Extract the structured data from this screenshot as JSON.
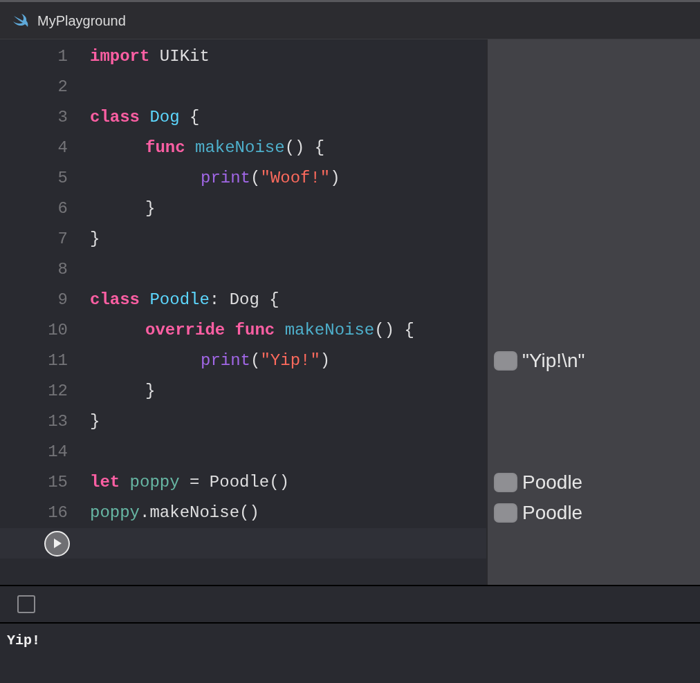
{
  "window": {
    "title": "MyPlayground"
  },
  "editor": {
    "lines": [
      {
        "number": "1",
        "tokens": [
          {
            "kind": "keyword",
            "text": "import"
          },
          {
            "kind": "plain",
            "text": " UIKit"
          }
        ]
      },
      {
        "number": "2"
      },
      {
        "number": "3",
        "tokens": [
          {
            "kind": "keyword",
            "text": "class"
          },
          {
            "kind": "type",
            "text": " Dog"
          },
          {
            "kind": "plain",
            "text": " {"
          }
        ],
        "children": [
          {
            "number": "4",
            "tokens": [
              {
                "kind": "keyword",
                "text": "func"
              },
              {
                "kind": "function",
                "text": " makeNoise"
              },
              {
                "kind": "plain",
                "text": "() {"
              }
            ],
            "children": [
              {
                "number": "5",
                "tokens": [
                  {
                    "kind": "builtin",
                    "text": "print"
                  },
                  {
                    "kind": "plain",
                    "text": "("
                  },
                  {
                    "kind": "string",
                    "text": "\"Woof!\""
                  },
                  {
                    "kind": "plain",
                    "text": ")"
                  }
                ]
              }
            ]
          },
          {
            "number": "6",
            "tokens": [
              {
                "kind": "plain",
                "text": "}"
              }
            ]
          }
        ]
      },
      {
        "number": "7",
        "tokens": [
          {
            "kind": "plain",
            "text": "}"
          }
        ]
      },
      {
        "number": "8"
      },
      {
        "number": "9",
        "tokens": [
          {
            "kind": "keyword",
            "text": "class"
          },
          {
            "kind": "type",
            "text": " Poodle"
          },
          {
            "kind": "plain",
            "text": ": Dog {"
          }
        ],
        "children": [
          {
            "number": "10",
            "tokens": [
              {
                "kind": "keyword",
                "text": "override"
              },
              {
                "kind": "keyword",
                "text": " func"
              },
              {
                "kind": "function",
                "text": " makeNoise"
              },
              {
                "kind": "plain",
                "text": "() {"
              }
            ],
            "children": [
              {
                "number": "11",
                "tokens": [
                  {
                    "kind": "builtin",
                    "text": "print"
                  },
                  {
                    "kind": "plain",
                    "text": "("
                  },
                  {
                    "kind": "string",
                    "text": "\"Yip!\""
                  },
                  {
                    "kind": "plain",
                    "text": ")"
                  }
                ],
                "result": "\"Yip!\\n\""
              }
            ]
          },
          {
            "number": "12",
            "tokens": [
              {
                "kind": "plain",
                "text": "}"
              }
            ]
          }
        ]
      },
      {
        "number": "13",
        "tokens": [
          {
            "kind": "plain",
            "text": "}"
          }
        ]
      },
      {
        "number": "14"
      },
      {
        "number": "15",
        "tokens": [
          {
            "kind": "keyword",
            "text": "let"
          },
          {
            "kind": "variable",
            "text": " poppy"
          },
          {
            "kind": "plain",
            "text": " = Poodle()"
          }
        ],
        "result": "Poodle"
      },
      {
        "number": "16",
        "tokens": [
          {
            "kind": "variable",
            "text": "poppy"
          },
          {
            "kind": "plain",
            "text": ".makeNoise()"
          }
        ],
        "result": "Poodle"
      }
    ]
  },
  "console": {
    "output": "Yip!"
  }
}
